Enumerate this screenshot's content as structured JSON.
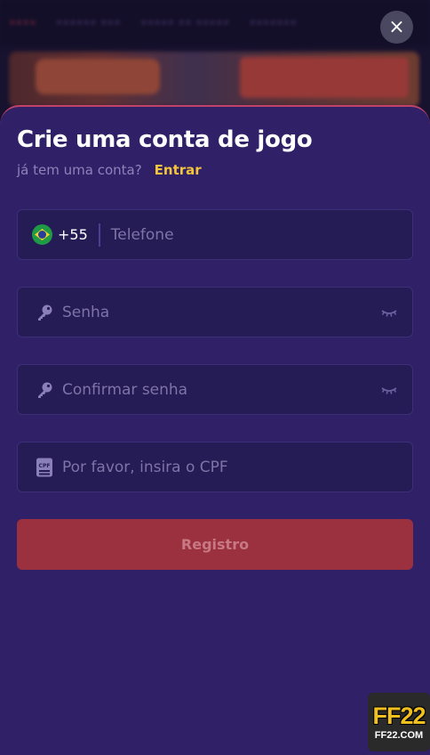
{
  "background": {
    "nav_items": [
      "••••",
      "•••••• •••",
      "••••• •• •••••",
      "•••••••"
    ]
  },
  "close": {
    "label": "×",
    "icon": "close-icon"
  },
  "form": {
    "title": "Crie uma conta de jogo",
    "subtitle": "já tem uma conta?",
    "login_link": "Entrar",
    "phone": {
      "country_code": "+55",
      "placeholder": "Telefone",
      "flag_icon": "brazil-flag-icon"
    },
    "password": {
      "placeholder": "Senha",
      "icon": "key-icon",
      "toggle_icon": "eye-closed-icon"
    },
    "confirm_password": {
      "placeholder": "Confirmar senha",
      "icon": "key-icon",
      "toggle_icon": "eye-closed-icon"
    },
    "cpf": {
      "placeholder": "Por favor, insira o CPF",
      "icon": "id-card-icon",
      "icon_text": "CPF"
    },
    "submit_label": "Registro"
  },
  "logo": {
    "main": "FF22",
    "sub": "FF22.COM"
  },
  "colors": {
    "sheet": "#2f2068",
    "field": "#251b55",
    "accent_link": "#f4c43a",
    "submit": "#9b303f"
  }
}
